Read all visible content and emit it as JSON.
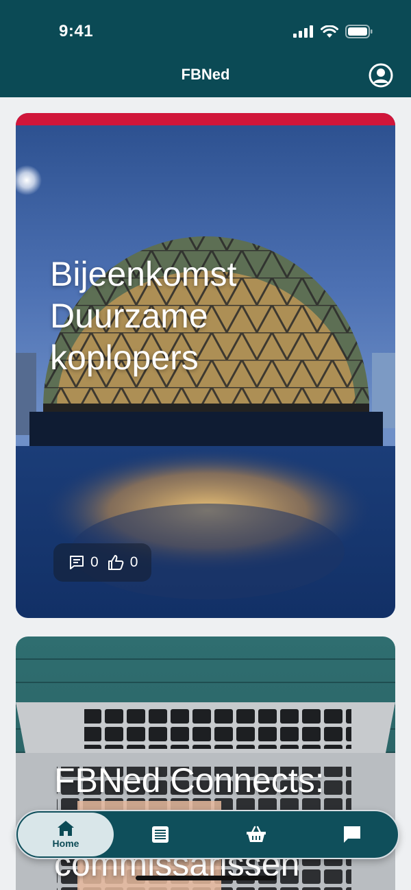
{
  "status_bar": {
    "time": "9:41"
  },
  "app_bar": {
    "title": "FBNed"
  },
  "feed": {
    "cards": [
      {
        "title": "Bijeenkomst Duurzame koplopers",
        "comments": "0",
        "likes": "0",
        "accent_color": "#d0163a"
      },
      {
        "title": "FBNed Connects: Duurzame commissarissen",
        "accent_color": ""
      }
    ]
  },
  "bottom_nav": {
    "items": [
      {
        "label": "Home",
        "icon": "home-icon",
        "active": true
      },
      {
        "label": "",
        "icon": "news-list-icon",
        "active": false
      },
      {
        "label": "",
        "icon": "basket-icon",
        "active": false
      },
      {
        "label": "",
        "icon": "chat-icon",
        "active": false
      }
    ]
  },
  "colors": {
    "brand": "#0b4a55",
    "accent": "#d0163a",
    "background": "#eef0f2"
  }
}
